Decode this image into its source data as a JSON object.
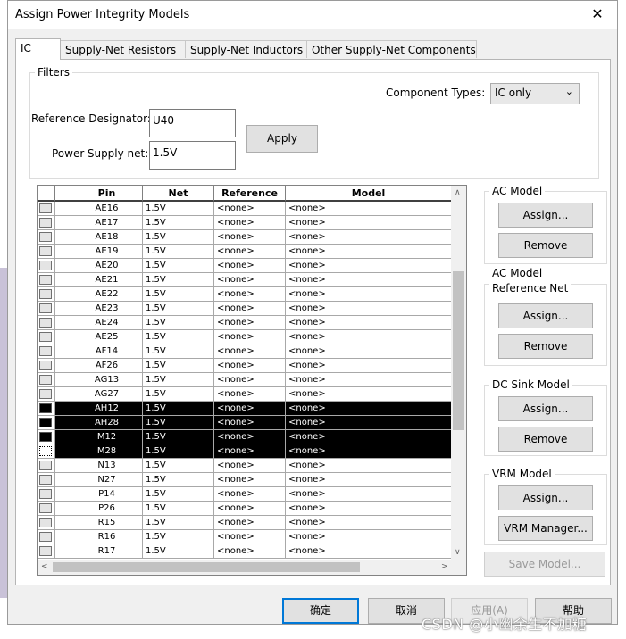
{
  "window": {
    "title": "Assign Power Integrity Models",
    "close_glyph": "✕"
  },
  "tabs": [
    {
      "label": "IC",
      "active": true
    },
    {
      "label": "Supply-Net Resistors"
    },
    {
      "label": "Supply-Net Inductors"
    },
    {
      "label": "Other Supply-Net Components"
    }
  ],
  "filters": {
    "group_title": "Filters",
    "component_types_label": "Component Types:",
    "component_types_value": "IC only",
    "ref_des_label": "Reference Designator:",
    "ref_des_value": "U40",
    "power_net_label": "Power-Supply net:",
    "power_net_value": "1.5V",
    "apply_label": "Apply"
  },
  "grid": {
    "columns": [
      "Pin",
      "Net",
      "Reference",
      "Model"
    ],
    "rows": [
      {
        "pin": "AE16",
        "net": "1.5V",
        "ref": "<none>",
        "model": "<none>"
      },
      {
        "pin": "AE17",
        "net": "1.5V",
        "ref": "<none>",
        "model": "<none>"
      },
      {
        "pin": "AE18",
        "net": "1.5V",
        "ref": "<none>",
        "model": "<none>"
      },
      {
        "pin": "AE19",
        "net": "1.5V",
        "ref": "<none>",
        "model": "<none>"
      },
      {
        "pin": "AE20",
        "net": "1.5V",
        "ref": "<none>",
        "model": "<none>"
      },
      {
        "pin": "AE21",
        "net": "1.5V",
        "ref": "<none>",
        "model": "<none>"
      },
      {
        "pin": "AE22",
        "net": "1.5V",
        "ref": "<none>",
        "model": "<none>"
      },
      {
        "pin": "AE23",
        "net": "1.5V",
        "ref": "<none>",
        "model": "<none>"
      },
      {
        "pin": "AE24",
        "net": "1.5V",
        "ref": "<none>",
        "model": "<none>"
      },
      {
        "pin": "AE25",
        "net": "1.5V",
        "ref": "<none>",
        "model": "<none>"
      },
      {
        "pin": "AF14",
        "net": "1.5V",
        "ref": "<none>",
        "model": "<none>"
      },
      {
        "pin": "AF26",
        "net": "1.5V",
        "ref": "<none>",
        "model": "<none>"
      },
      {
        "pin": "AG13",
        "net": "1.5V",
        "ref": "<none>",
        "model": "<none>"
      },
      {
        "pin": "AG27",
        "net": "1.5V",
        "ref": "<none>",
        "model": "<none>"
      },
      {
        "pin": "AH12",
        "net": "1.5V",
        "ref": "<none>",
        "model": "<none>",
        "selected": true
      },
      {
        "pin": "AH28",
        "net": "1.5V",
        "ref": "<none>",
        "model": "<none>",
        "selected": true
      },
      {
        "pin": "M12",
        "net": "1.5V",
        "ref": "<none>",
        "model": "<none>",
        "selected": true
      },
      {
        "pin": "M28",
        "net": "1.5V",
        "ref": "<none>",
        "model": "<none>",
        "selected": true,
        "focused": true
      },
      {
        "pin": "N13",
        "net": "1.5V",
        "ref": "<none>",
        "model": "<none>"
      },
      {
        "pin": "N27",
        "net": "1.5V",
        "ref": "<none>",
        "model": "<none>"
      },
      {
        "pin": "P14",
        "net": "1.5V",
        "ref": "<none>",
        "model": "<none>"
      },
      {
        "pin": "P26",
        "net": "1.5V",
        "ref": "<none>",
        "model": "<none>"
      },
      {
        "pin": "R15",
        "net": "1.5V",
        "ref": "<none>",
        "model": "<none>"
      },
      {
        "pin": "R16",
        "net": "1.5V",
        "ref": "<none>",
        "model": "<none>"
      },
      {
        "pin": "R17",
        "net": "1.5V",
        "ref": "<none>",
        "model": "<none>"
      }
    ]
  },
  "side": {
    "ac_model": {
      "title": "AC Model",
      "assign": "Assign...",
      "remove": "Remove"
    },
    "ac_ref_net": {
      "title_line1": "AC Model",
      "title_line2": "Reference Net",
      "assign": "Assign...",
      "remove": "Remove"
    },
    "dc_sink": {
      "title": "DC Sink Model",
      "assign": "Assign...",
      "remove": "Remove"
    },
    "vrm": {
      "title": "VRM Model",
      "assign": "Assign...",
      "manager": "VRM Manager..."
    },
    "save_model": "Save Model..."
  },
  "footer": {
    "ok": "确定",
    "cancel": "取消",
    "apply": "应用(A)",
    "help": "帮助"
  },
  "watermark": "CSDN @小幽余生不加糖"
}
